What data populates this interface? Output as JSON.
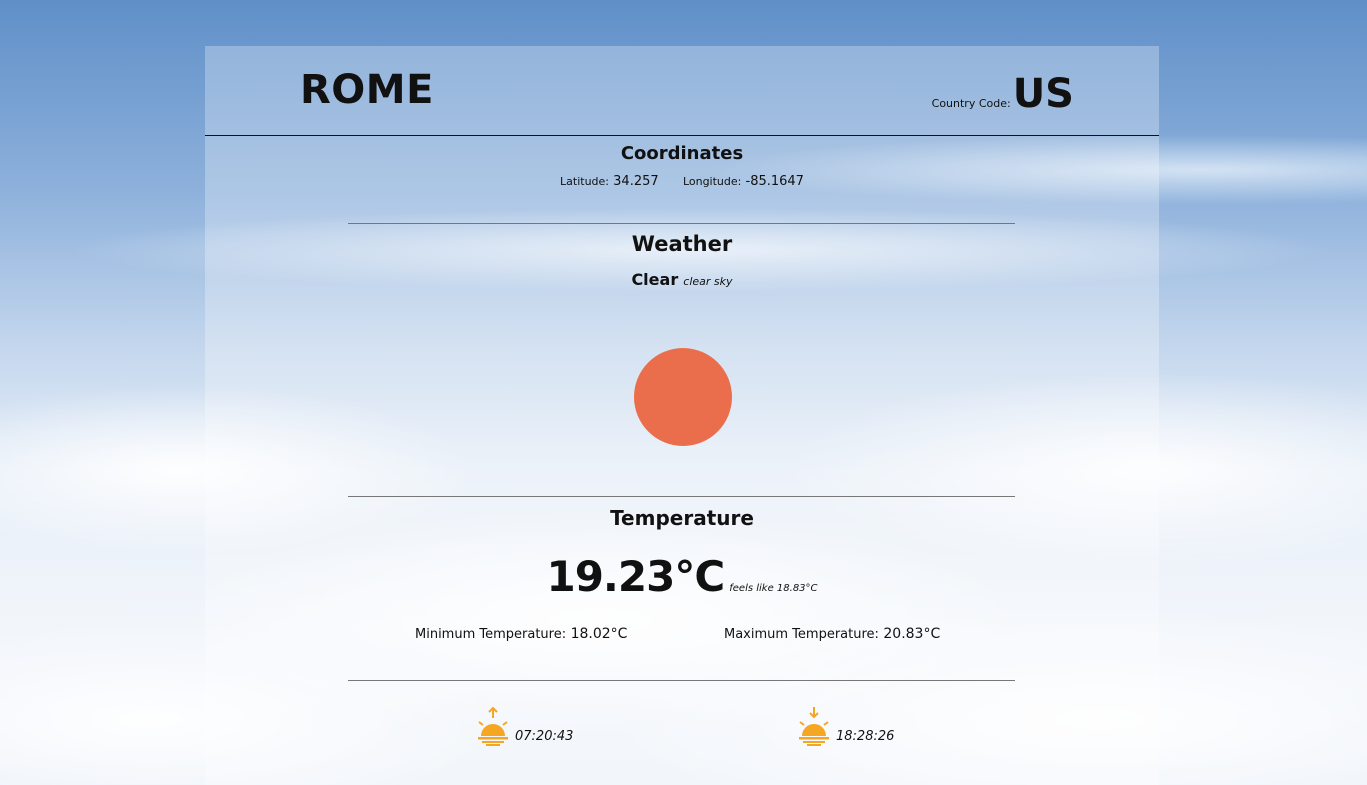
{
  "city": "ROME",
  "country": {
    "label": "Country Code:",
    "code": "US"
  },
  "coordinates": {
    "title": "Coordinates",
    "latitude_label": "Latitude:",
    "latitude": "34.257",
    "longitude_label": "Longitude:",
    "longitude": "-85.1647"
  },
  "weather": {
    "title": "Weather",
    "main": "Clear",
    "description": "clear sky",
    "icon": "sun-disc-icon",
    "icon_color": "#ea6e4b"
  },
  "temperature": {
    "title": "Temperature",
    "current": "19.23°C",
    "feels_like": "feels like 18.83°C",
    "min_label": "Minimum Temperature:",
    "min": "18.02°C",
    "max_label": "Maximum Temperature:",
    "max": "20.83°C"
  },
  "sun": {
    "sunrise_icon": "sunrise-icon",
    "sunrise": "07:20:43",
    "sunset_icon": "sunset-icon",
    "sunset": "18:28:26",
    "icon_color": "#f5a623"
  }
}
